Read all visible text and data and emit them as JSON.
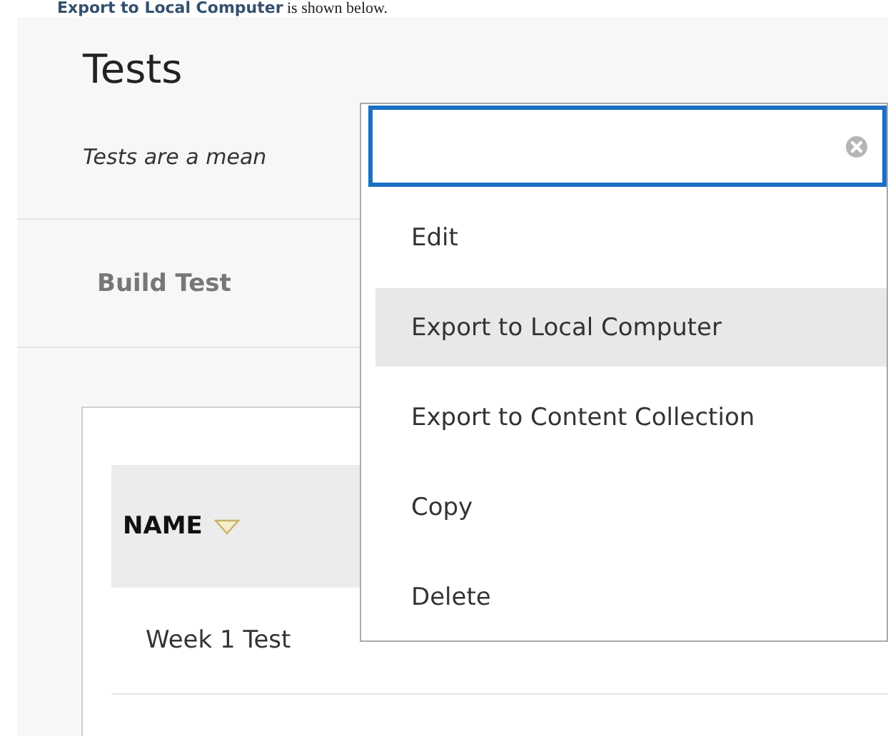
{
  "caption": "**Export to Local Computer** is shown below.",
  "page": {
    "title": "Tests",
    "description": "Tests are a mean",
    "action": "Build Test"
  },
  "table": {
    "columns": [
      {
        "label": "NAME",
        "sorted": true
      }
    ],
    "rows": [
      {
        "name": "Week 1 Test"
      }
    ]
  },
  "menu": {
    "search": true,
    "items": [
      {
        "label": "Edit",
        "selected": false
      },
      {
        "label": "Export to Local Computer",
        "selected": true
      },
      {
        "label": "Export to Content Collection",
        "selected": false
      },
      {
        "label": "Copy",
        "selected": false
      },
      {
        "label": "Delete",
        "selected": false
      }
    ]
  }
}
